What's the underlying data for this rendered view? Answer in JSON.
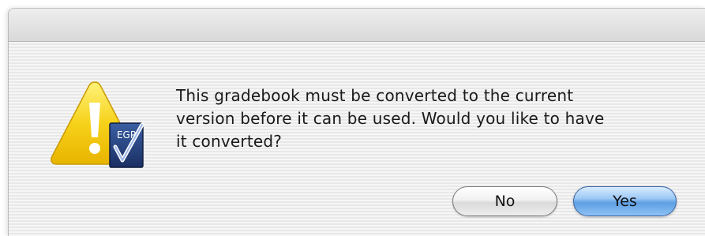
{
  "dialog": {
    "message": "This gradebook must be converted to the current version before it can be used. Would you like to have it converted?",
    "message_lines": [
      "This gradebook must be converted to the current",
      "version before it can be used. Would you like to have",
      "it converted?"
    ],
    "icon": {
      "semantic": "warning-icon",
      "badge_text": "EGP"
    },
    "buttons": {
      "no_label": "No",
      "yes_label": "Yes"
    }
  },
  "colors": {
    "default_button": "#6aa6e8",
    "warning_yellow": "#f5c400",
    "badge_blue": "#24407a"
  }
}
